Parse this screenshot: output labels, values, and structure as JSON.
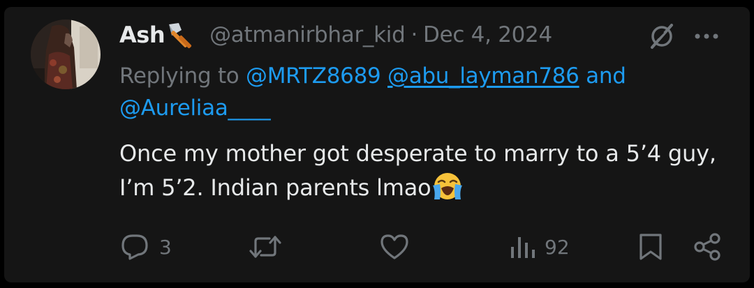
{
  "post": {
    "display_name": "Ash",
    "name_emoji_icon": "axe-icon",
    "handle": "@atmanirbhar_kid",
    "separator": "·",
    "date": "Dec 4, 2024",
    "replying_prefix": "Replying to",
    "mentions": [
      "@MRTZ8689",
      "@abu_layman786",
      "@Aureliaa____"
    ],
    "mentions_joiner": "and",
    "text": "Once my mother got desperate to marry to a 5’4 guy, I’m 5’2. Indian parents lmao",
    "text_emoji_icon": "loudly-crying-face-icon"
  },
  "actions": {
    "reply_count": "3",
    "repost_count": "",
    "like_count": "",
    "views_count": "92"
  },
  "colors": {
    "background": "#000000",
    "card": "#151515",
    "primary_text": "#e7e9ea",
    "secondary_text": "#71767b",
    "link": "#1d9bf0"
  }
}
